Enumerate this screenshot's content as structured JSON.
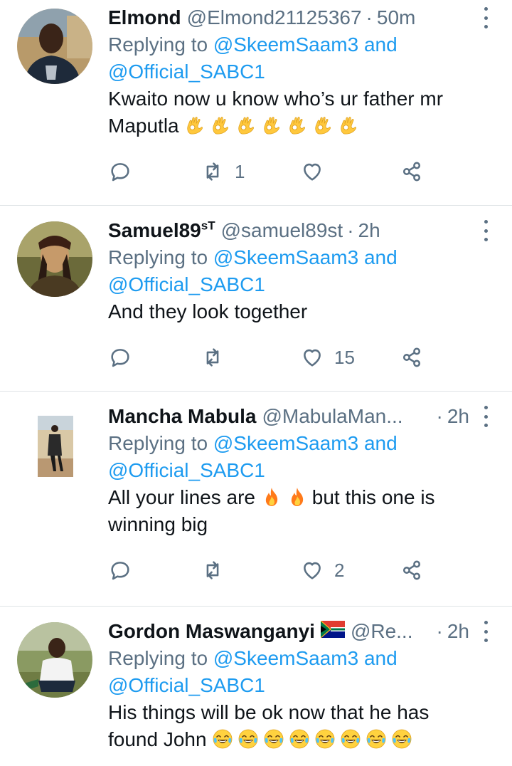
{
  "colors": {
    "link": "#1d9bf0",
    "secondary": "#5b7083",
    "text": "#0f1419",
    "divider": "#dfe3e6"
  },
  "tweets": [
    {
      "name": "Elmond",
      "name_sup": "",
      "handle": "@Elmond21125367",
      "time": "50m",
      "replying_prefix": "Replying to ",
      "replying_to_1": "@SkeemSaam3",
      "replying_and": " and",
      "replying_to_2": "@Official_SABC1",
      "text_line_1": "Kwaito now u know who’s ur father mr",
      "text_line_2": "Maputla",
      "emoji": "ok-hand",
      "emoji_count": 7,
      "reply_count": "",
      "retweet_count": "1",
      "like_count": ""
    },
    {
      "name": "Samuel89",
      "name_sup": "sT",
      "handle": "@samuel89st",
      "time": "2h",
      "replying_prefix": "Replying to ",
      "replying_to_1": "@SkeemSaam3",
      "replying_and": " and",
      "replying_to_2": "@Official_SABC1",
      "text_line_1": "And they look together",
      "reply_count": "",
      "retweet_count": "",
      "like_count": "15"
    },
    {
      "name": "Mancha Mabula",
      "handle": "@MabulaMan...",
      "time": "2h",
      "replying_prefix": "Replying to ",
      "replying_to_1": "@SkeemSaam3",
      "replying_and": " and",
      "replying_to_2": "@Official_SABC1",
      "text_line_1_a": "All your lines are",
      "text_line_1_b": "but this one is",
      "text_line_2": "winning big",
      "emoji": "fire",
      "emoji_count": 2,
      "reply_count": "",
      "retweet_count": "",
      "like_count": "2"
    },
    {
      "name": "Gordon Maswanganyi",
      "handle": "@Re...",
      "time": "2h",
      "flag": "south-africa-flag",
      "replying_prefix": "Replying to ",
      "replying_to_1": "@SkeemSaam3",
      "replying_and": " and",
      "replying_to_2": "@Official_SABC1",
      "text_line_1": "His things will be ok now that he has",
      "text_line_2": "found John",
      "emoji": "tears-of-joy",
      "emoji_count": 8
    }
  ],
  "icons": {
    "reply": "reply-icon",
    "retweet": "retweet-icon",
    "like": "heart-icon",
    "share": "share-icon",
    "more": "more-vertical-icon"
  }
}
